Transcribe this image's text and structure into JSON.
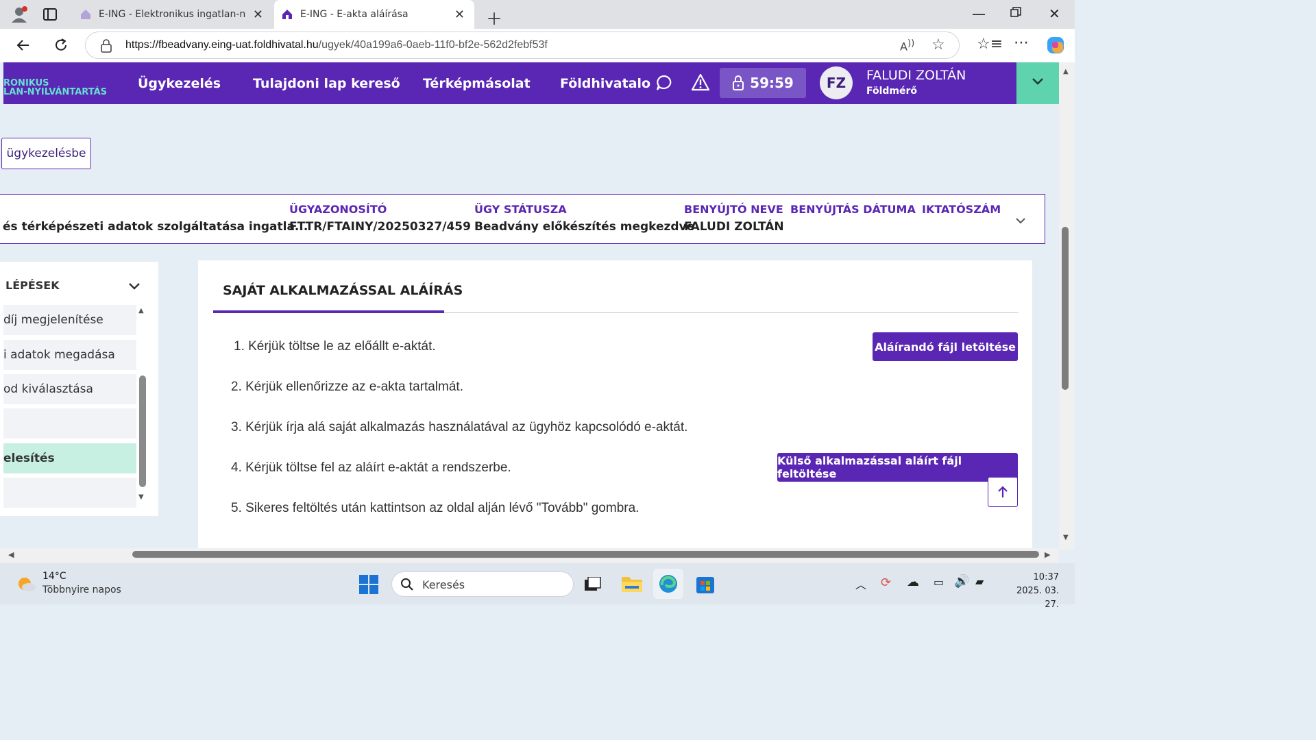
{
  "browser": {
    "tabs": [
      {
        "title": "E-ING - Elektronikus ingatlan-nyil",
        "active": false
      },
      {
        "title": "E-ING - E-akta aláírása",
        "active": true
      }
    ],
    "url_host": "https://fbeadvany.eing-uat.foldhivatal.hu",
    "url_path": "/ugyek/40a199a6-0aeb-11f0-bf2e-562d2febf53f"
  },
  "header": {
    "logo_line1": "RONIKUS",
    "logo_line2": "LAN-NYILVÁNTARTÁS",
    "nav": [
      "Ügykezelés",
      "Tulajdoni lap kereső",
      "Térképmásolat",
      "Földhivatalo"
    ],
    "timer": "59:59",
    "avatar_initials": "FZ",
    "user_name": "FALUDI ZOLTÁN",
    "user_role": "Földmérő"
  },
  "back_button": "ügykezelésbe",
  "case_info": {
    "service_value": "és térképészeti adatok szolgáltatása ingatla...",
    "id_label": "ÜGYAZONOSÍTÓ",
    "id_value": "FTTR/FTAINY/20250327/459",
    "status_label": "ÜGY STÁTUSZA",
    "status_value": "Beadvány előkészítés megkezdve",
    "submitter_label": "BENYÚJTÓ NEVE",
    "submitter_value": "FALUDI ZOLTÁN",
    "date_label": "BENYÚJTÁS DÁTUMA",
    "filing_label": "IKTATÓSZÁM"
  },
  "steps_panel": {
    "title": "LÉPÉSEK",
    "items": [
      {
        "label": "díj megjelenítése",
        "active": false
      },
      {
        "label": "i adatok megadása",
        "active": false
      },
      {
        "label": "od kiválasztása",
        "active": false
      },
      {
        "label": "",
        "active": false
      },
      {
        "label": "elesítés",
        "active": true
      },
      {
        "label": "",
        "active": false
      }
    ]
  },
  "signing": {
    "tab_title": "SAJÁT ALKALMAZÁSSAL ALÁÍRÁS",
    "steps": [
      "1. Kérjük töltse le az előállt e-aktát.",
      "2. Kérjük ellenőrizze az e-akta tartalmát.",
      "3. Kérjük írja alá saját alkalmazás használatával az ügyhöz kapcsolódó e-aktát.",
      "4. Kérjük töltse fel az aláírt e-aktát a rendszerbe.",
      "5. Sikeres feltöltés után kattintson az oldal alján lévő \"Tovább\" gombra."
    ],
    "download_button": "Aláírandó fájl letöltése",
    "upload_button": "Külső alkalmazással aláírt fájl feltöltése"
  },
  "taskbar": {
    "weather_temp": "14°C",
    "weather_desc": "Többnyire napos",
    "search_placeholder": "Keresés",
    "time": "10:37",
    "date": "2025. 03. 27."
  },
  "colors": {
    "brand": "#5a26b4",
    "accent_green": "#5fd3ad",
    "active_step": "#c7f0e2"
  }
}
